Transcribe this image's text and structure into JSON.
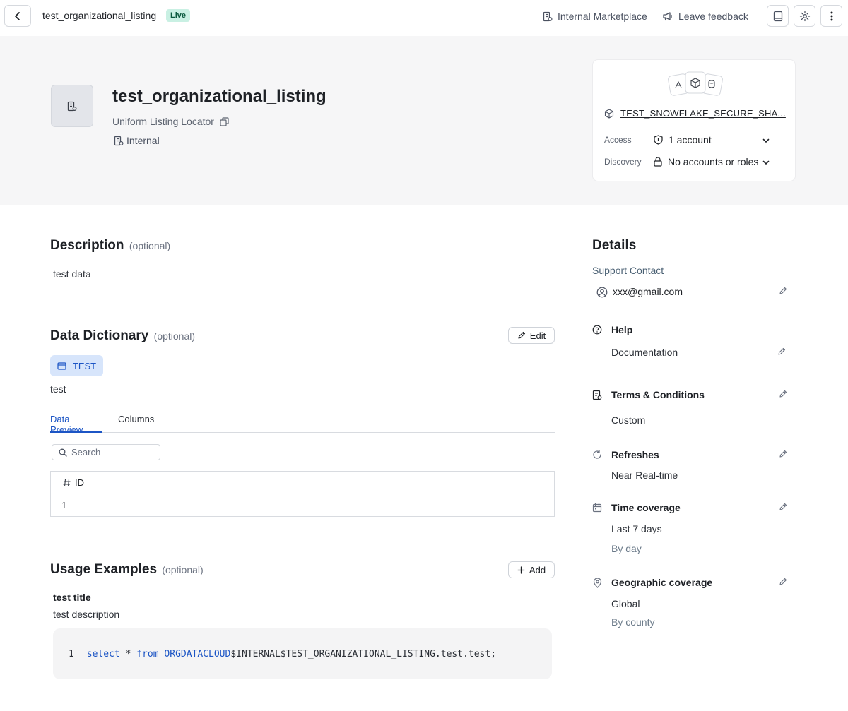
{
  "topbar": {
    "title": "test_organizational_listing",
    "badge": "Live",
    "marketplace_label": "Internal Marketplace",
    "feedback_label": "Leave feedback"
  },
  "hero": {
    "title": "test_organizational_listing",
    "locator_label": "Uniform Listing Locator",
    "visibility": "Internal"
  },
  "share_card": {
    "share_name": "TEST_SNOWFLAKE_SECURE_SHA...",
    "access_label": "Access",
    "access_value": "1 account",
    "discovery_label": "Discovery",
    "discovery_value": "No accounts or roles"
  },
  "description": {
    "heading": "Description",
    "optional": "(optional)",
    "text": "test data"
  },
  "data_dictionary": {
    "heading": "Data Dictionary",
    "optional": "(optional)",
    "edit_label": "Edit",
    "object_chip": "TEST",
    "object_description": "test",
    "tabs": [
      {
        "label": "Data Preview",
        "active": true
      },
      {
        "label": "Columns",
        "active": false
      }
    ],
    "search_placeholder": "Search",
    "table": {
      "columns": [
        "ID"
      ],
      "rows": [
        [
          "1"
        ]
      ]
    }
  },
  "usage_examples": {
    "heading": "Usage Examples",
    "optional": "(optional)",
    "add_label": "Add",
    "example_title": "test title",
    "example_description": "test description",
    "code": {
      "line_number": "1",
      "kw_select": "select",
      "star": " * ",
      "kw_from": "from",
      "db_name": " ORGDATACLOUD",
      "rest": "$INTERNAL$TEST_ORGANIZATIONAL_LISTING.test.test;"
    }
  },
  "details": {
    "heading": "Details",
    "support_contact_label": "Support Contact",
    "support_email": "xxx@gmail.com",
    "help_label": "Help",
    "help_value": "Documentation",
    "terms_label": "Terms & Conditions",
    "terms_value": "Custom",
    "refreshes_label": "Refreshes",
    "refreshes_value": "Near Real-time",
    "time_coverage_label": "Time coverage",
    "time_coverage_value": "Last 7 days",
    "time_coverage_granularity": "By day",
    "geo_label": "Geographic coverage",
    "geo_value": "Global",
    "geo_granularity": "By county"
  },
  "colors": {
    "accent": "#1c55c5",
    "live_badge_bg": "#c9f0e3",
    "hero_bg": "#f6f6f7"
  }
}
